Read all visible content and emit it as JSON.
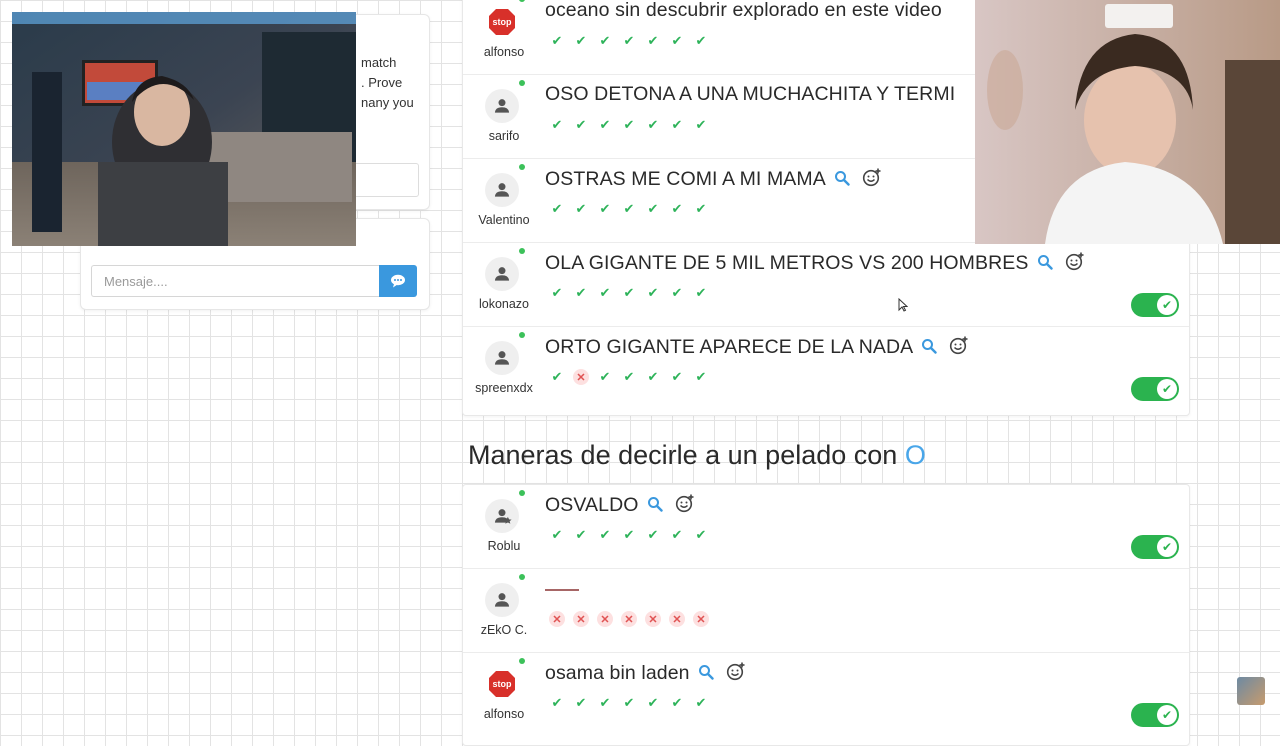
{
  "chat": {
    "lines": [
      "match",
      ". Prove",
      "nany you"
    ],
    "message_placeholder": "Mensaje...."
  },
  "category_title": {
    "text": "Maneras de decirle a un pelado con",
    "letter": "O"
  },
  "answers_top": [
    {
      "user": "alfonso",
      "avatar": "stop",
      "text": "oceano sin descubrir explorado en este video",
      "marks": [
        "ok",
        "ok",
        "ok",
        "ok",
        "ok",
        "ok",
        "ok"
      ],
      "toggle": false,
      "icons": false
    },
    {
      "user": "sarifo",
      "avatar": "person",
      "text": "OSO DETONA A UNA MUCHACHITA Y TERMI",
      "marks": [
        "ok",
        "ok",
        "ok",
        "ok",
        "ok",
        "ok",
        "ok"
      ],
      "toggle": false,
      "icons": false
    },
    {
      "user": "Valentino",
      "avatar": "person",
      "text": "OSTRAS ME COMI A MI MAMA",
      "marks": [
        "ok",
        "ok",
        "ok",
        "ok",
        "ok",
        "ok",
        "ok"
      ],
      "toggle": false,
      "icons": true
    },
    {
      "user": "lokonazo",
      "avatar": "person",
      "text": "OLA GIGANTE DE 5 MIL METROS VS 200 HOMBRES",
      "marks": [
        "ok",
        "ok",
        "ok",
        "ok",
        "ok",
        "ok",
        "ok"
      ],
      "toggle": true,
      "icons": true
    },
    {
      "user": "spreenxdx",
      "avatar": "person",
      "text": "ORTO GIGANTE APARECE DE LA NADA",
      "marks": [
        "ok",
        "no",
        "ok",
        "ok",
        "ok",
        "ok",
        "ok"
      ],
      "toggle": true,
      "icons": true
    }
  ],
  "answers_bottom": [
    {
      "user": "Roblu",
      "avatar": "person-star",
      "text": "OSVALDO",
      "marks": [
        "ok",
        "ok",
        "ok",
        "ok",
        "ok",
        "ok",
        "ok"
      ],
      "toggle": true,
      "icons": true
    },
    {
      "user": "zEkO C.",
      "avatar": "person",
      "text": "",
      "marks": [
        "no",
        "no",
        "no",
        "no",
        "no",
        "no",
        "no"
      ],
      "toggle": false,
      "icons": false
    },
    {
      "user": "alfonso",
      "avatar": "stop",
      "text": "osama bin laden",
      "marks": [
        "ok",
        "ok",
        "ok",
        "ok",
        "ok",
        "ok",
        "ok"
      ],
      "toggle": true,
      "icons": true
    }
  ],
  "icons": {
    "search": "search-icon",
    "emoji": "emoji-add-icon",
    "send": "chat-send-icon",
    "check": "check-icon",
    "cross": "cross-icon"
  },
  "colors": {
    "accent": "#3a98de",
    "toggle_on": "#2bb34f",
    "check": "#2eb35a",
    "cross": "#e05353",
    "letter": "#49a6e9"
  },
  "stop_label": "stop"
}
